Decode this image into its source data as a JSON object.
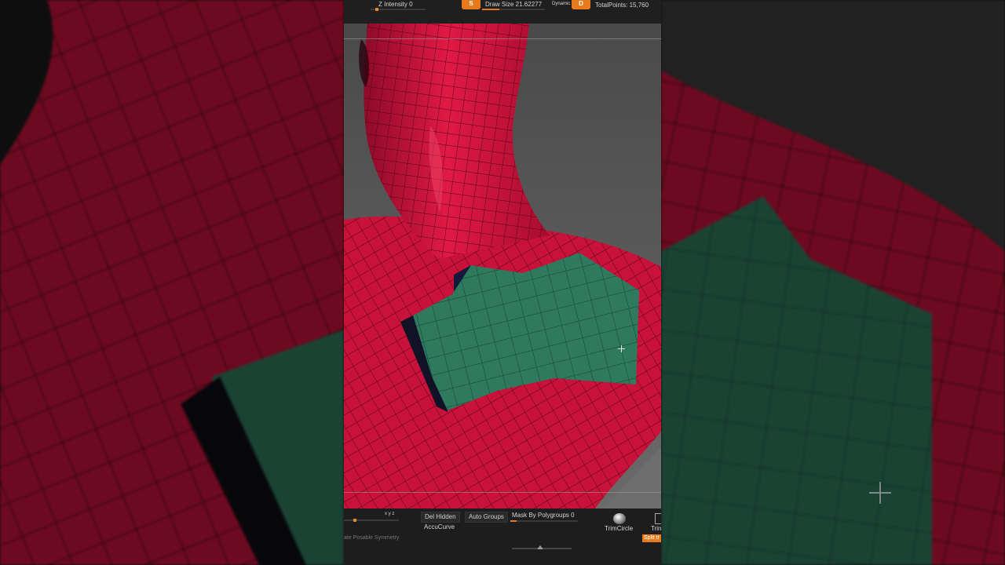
{
  "topbar": {
    "z_intensity_label": "Z Intensity 0",
    "brush_s_label": "S",
    "draw_size_label": "Draw Size 21.62277",
    "dynamic_label": "Dynamic",
    "brush_d_label": "D",
    "total_points_label": "TotalPoints: 15,760"
  },
  "bottombar": {
    "xyz_label": "x y z",
    "del_hidden_label": "Del Hidden",
    "auto_groups_label": "Auto Groups",
    "mask_polygroups_label": "Mask By Polygroups 0",
    "accucurve_label": "AccuCurve",
    "posable_symmetry_label": "ate Posable Symmetry",
    "trimcircle_label": "TrimCircle",
    "trim_partial_label": "Trin",
    "split_tag_label": "Split tr",
    "mask_polygroups_value": 0
  },
  "colors": {
    "accent": "#e87a1e",
    "mesh_red": "#c8123a",
    "polygroup_green": "#2f7a5e",
    "viewport_bg": "#5a5a5a"
  },
  "icons": [
    "brush-s-icon",
    "brush-d-icon",
    "crosshair-cursor-icon",
    "trimcircle-sphere-icon",
    "trim-brush-icon"
  ]
}
